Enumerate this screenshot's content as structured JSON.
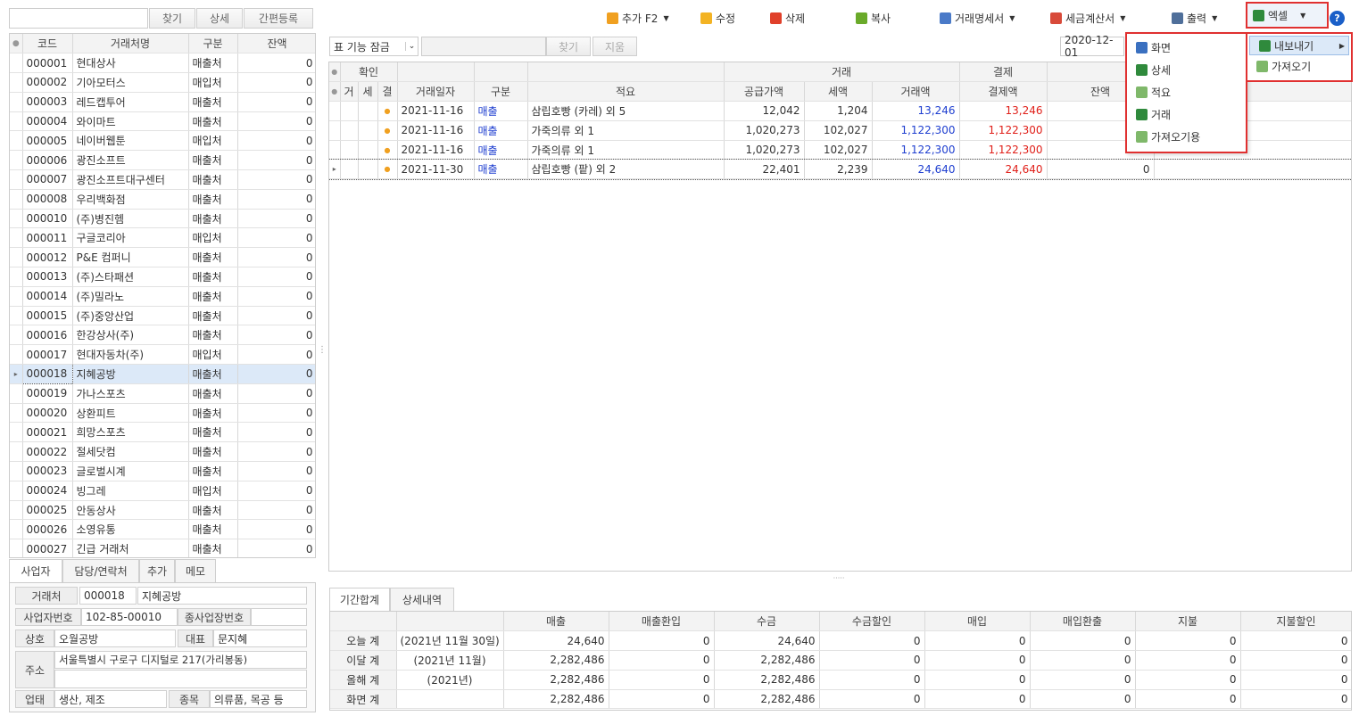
{
  "left_toolbar": {
    "search": "찾기",
    "detail": "상세",
    "quick_register": "간편등록"
  },
  "client_table": {
    "headers": [
      "코드",
      "거래처명",
      "구분",
      "잔액"
    ],
    "rows": [
      [
        "000001",
        "현대상사",
        "매출처",
        "0"
      ],
      [
        "000002",
        "기아모터스",
        "매입처",
        "0"
      ],
      [
        "000003",
        "레드캡투어",
        "매출처",
        "0"
      ],
      [
        "000004",
        "와이마트",
        "매출처",
        "0"
      ],
      [
        "000005",
        "네이버웹툰",
        "매입처",
        "0"
      ],
      [
        "000006",
        "광진소프트",
        "매출처",
        "0"
      ],
      [
        "000007",
        "광진소프트대구센터",
        "매출처",
        "0"
      ],
      [
        "000008",
        "우리백화점",
        "매출처",
        "0"
      ],
      [
        "000010",
        "(주)병진헴",
        "매출처",
        "0"
      ],
      [
        "000011",
        "구글코리아",
        "매입처",
        "0"
      ],
      [
        "000012",
        "P&E 컴퍼니",
        "매출처",
        "0"
      ],
      [
        "000013",
        "(주)스타패션",
        "매출처",
        "0"
      ],
      [
        "000014",
        "(주)밀라노",
        "매출처",
        "0"
      ],
      [
        "000015",
        "(주)중앙산업",
        "매출처",
        "0"
      ],
      [
        "000016",
        "한강상사(주)",
        "매출처",
        "0"
      ],
      [
        "000017",
        "현대자동차(주)",
        "매입처",
        "0"
      ],
      [
        "000018",
        "지혜공방",
        "매출처",
        "0"
      ],
      [
        "000019",
        "가나스포츠",
        "매출처",
        "0"
      ],
      [
        "000020",
        "상환피트",
        "매출처",
        "0"
      ],
      [
        "000021",
        "희망스포츠",
        "매출처",
        "0"
      ],
      [
        "000022",
        "절세닷컴",
        "매출처",
        "0"
      ],
      [
        "000023",
        "글로벌시계",
        "매출처",
        "0"
      ],
      [
        "000024",
        "빙그레",
        "매입처",
        "0"
      ],
      [
        "000025",
        "안동상사",
        "매출처",
        "0"
      ],
      [
        "000026",
        "소영유통",
        "매출처",
        "0"
      ],
      [
        "000027",
        "긴급 거래처",
        "매출처",
        "0"
      ]
    ]
  },
  "left_tabs": [
    "사업자",
    "담당/연락처",
    "추가",
    "메모"
  ],
  "detail": {
    "client_label": "거래처",
    "client_code": "000018",
    "client_name": "지혜공방",
    "biz_no_label": "사업자번호",
    "biz_no": "102-85-00010",
    "branch_label": "종사업장번호",
    "branch_value": "",
    "company_label": "상호",
    "company": "오월공방",
    "ceo_label": "대표",
    "ceo": "문지혜",
    "address_label": "주소",
    "address": "서울특별시 구로구 디지털로 217(가리봉동)",
    "type_label": "업태",
    "type": "생산, 제조",
    "item_label": "종목",
    "item": "의류품, 목공 등"
  },
  "toolbar": {
    "add": "추가 F2",
    "edit": "수정",
    "delete": "삭제",
    "copy": "복사",
    "statement": "거래명세서",
    "tax_invoice": "세금계산서",
    "print": "출력",
    "excel": "엑셀",
    "help": "?"
  },
  "filter": {
    "lock": "표 기능 잠금",
    "search": "찾기",
    "clear": "지움",
    "date": "2020-12-01"
  },
  "tx_table": {
    "group_confirm": "확인",
    "group_trade": "거래",
    "group_pay": "결제",
    "headers": [
      "거",
      "세",
      "결",
      "거래일자",
      "구분",
      "적요",
      "공급가액",
      "세액",
      "거래액",
      "결제액",
      "잔액"
    ],
    "rows": [
      {
        "date": "2021-11-16",
        "type": "매출",
        "memo": "삼립호빵 (카레) 외 5",
        "supply": "12,042",
        "tax": "1,204",
        "amount": "13,246",
        "paid": "13,246",
        "balance": ""
      },
      {
        "date": "2021-11-16",
        "type": "매출",
        "memo": "가죽의류 외 1",
        "supply": "1,020,273",
        "tax": "102,027",
        "amount": "1,122,300",
        "paid": "1,122,300",
        "balance": ""
      },
      {
        "date": "2021-11-16",
        "type": "매출",
        "memo": "가죽의류 외 1",
        "supply": "1,020,273",
        "tax": "102,027",
        "amount": "1,122,300",
        "paid": "1,122,300",
        "balance": ""
      },
      {
        "date": "2021-11-30",
        "type": "매출",
        "memo": "삼립호빵 (팥) 외 2",
        "supply": "22,401",
        "tax": "2,239",
        "amount": "24,640",
        "paid": "24,640",
        "balance": "0"
      }
    ]
  },
  "menu": {
    "items": [
      "화면",
      "상세",
      "적요",
      "거래",
      "가져오기용"
    ],
    "submenu": [
      "내보내기",
      "가져오기"
    ]
  },
  "bottom_tabs": [
    "기간합계",
    "상세내역"
  ],
  "summary": {
    "headers": [
      "매출",
      "매출환입",
      "수금",
      "수금할인",
      "매입",
      "매입환출",
      "지불",
      "지불할인"
    ],
    "rows": [
      {
        "label": "오늘 계",
        "period": "(2021년 11월 30일)",
        "values": [
          "24,640",
          "0",
          "24,640",
          "0",
          "0",
          "0",
          "0",
          "0"
        ]
      },
      {
        "label": "이달 계",
        "period": "(2021년 11월)",
        "values": [
          "2,282,486",
          "0",
          "2,282,486",
          "0",
          "0",
          "0",
          "0",
          "0"
        ]
      },
      {
        "label": "올해 계",
        "period": "(2021년)",
        "values": [
          "2,282,486",
          "0",
          "2,282,486",
          "0",
          "0",
          "0",
          "0",
          "0"
        ]
      },
      {
        "label": "화면 계",
        "period": "",
        "values": [
          "2,282,486",
          "0",
          "2,282,486",
          "0",
          "0",
          "0",
          "0",
          "0"
        ]
      }
    ]
  },
  "colors": {
    "highlight_red": "#e03030",
    "selected_row": "#dce9f8",
    "blue_text": "#1f3fd0",
    "red_text": "#e0201a"
  }
}
